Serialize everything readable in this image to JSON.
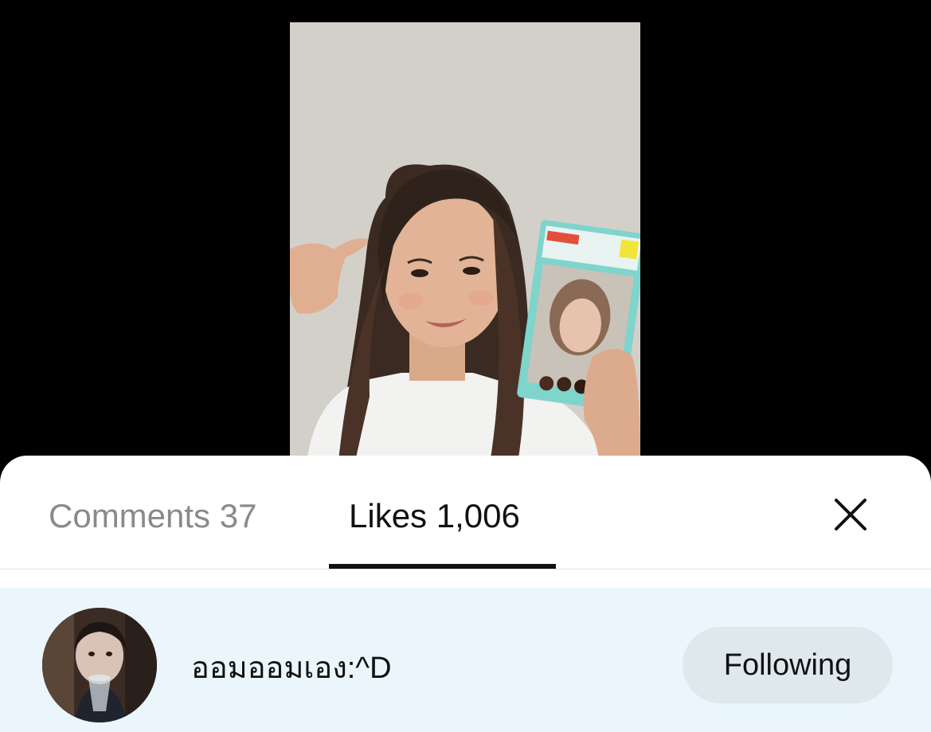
{
  "tabs": {
    "comments_label": "Comments 37",
    "likes_label": "Likes 1,006",
    "active": "likes"
  },
  "likes_list": [
    {
      "username": "ออมออมเอง:^D",
      "button_label": "Following"
    }
  ],
  "icons": {
    "close": "close-icon",
    "avatar": "avatar"
  },
  "colors": {
    "sheet_background": "#ffffff",
    "row_highlight": "#eaf6fb",
    "inactive_tab": "#8a8a8a",
    "active_tab": "#111111",
    "button_background": "#dfe8ec"
  }
}
